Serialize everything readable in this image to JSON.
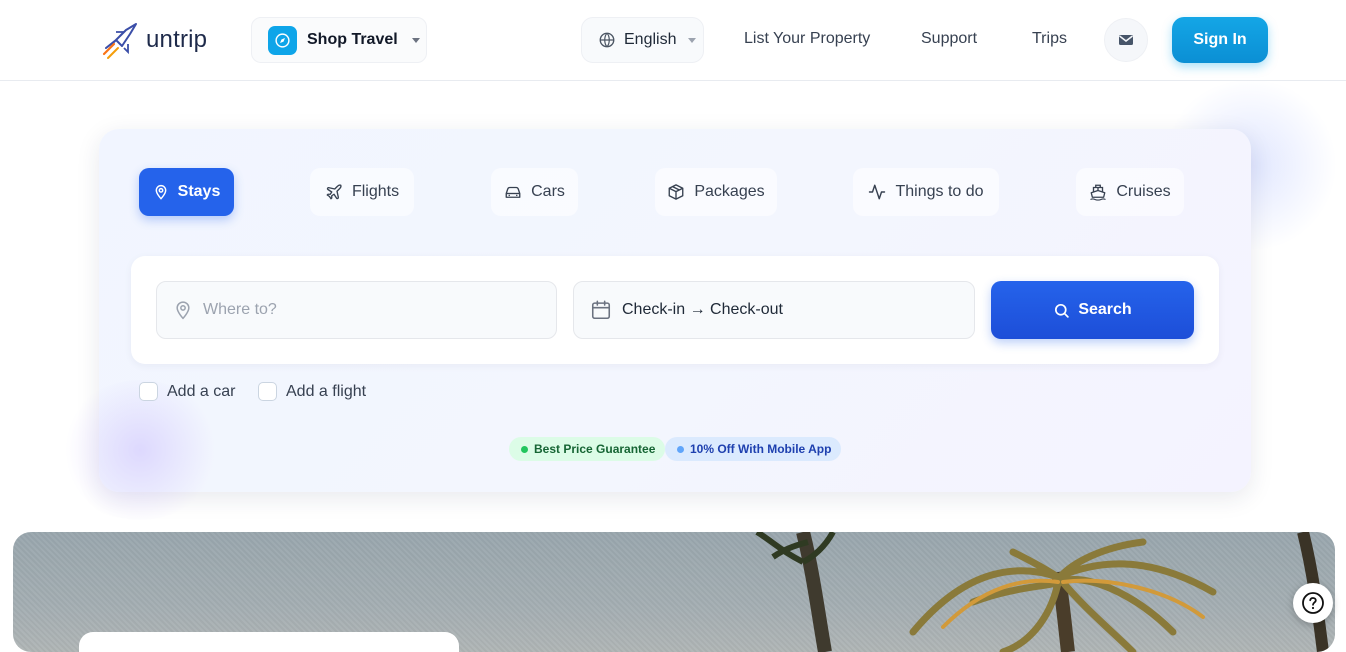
{
  "header": {
    "logo_text": "untrip",
    "shop_travel_label": "Shop Travel",
    "language_label": "English",
    "nav": [
      {
        "label": "List Your Property"
      },
      {
        "label": "Support"
      },
      {
        "label": "Trips"
      }
    ],
    "sign_in_label": "Sign In"
  },
  "search": {
    "tabs": [
      {
        "label": "Stays",
        "icon": "map-pin-icon",
        "active": true
      },
      {
        "label": "Flights",
        "icon": "plane-icon",
        "active": false
      },
      {
        "label": "Cars",
        "icon": "car-icon",
        "active": false
      },
      {
        "label": "Packages",
        "icon": "package-icon",
        "active": false
      },
      {
        "label": "Things to do",
        "icon": "activity-icon",
        "active": false
      },
      {
        "label": "Cruises",
        "icon": "ship-icon",
        "active": false
      }
    ],
    "destination_placeholder": "Where to?",
    "dates_label": "Check-in → Check-out",
    "search_button_label": "Search",
    "options": [
      {
        "label": "Add a car",
        "checked": false
      },
      {
        "label": "Add a flight",
        "checked": false
      }
    ],
    "badges": [
      {
        "label": "Best Price Guarantee",
        "color": "#22c55e"
      },
      {
        "label": "10% Off With Mobile App",
        "color": "#60a5fa"
      }
    ]
  },
  "colors": {
    "accent": "#2563eb",
    "sign_in": "#0ea5e9"
  }
}
